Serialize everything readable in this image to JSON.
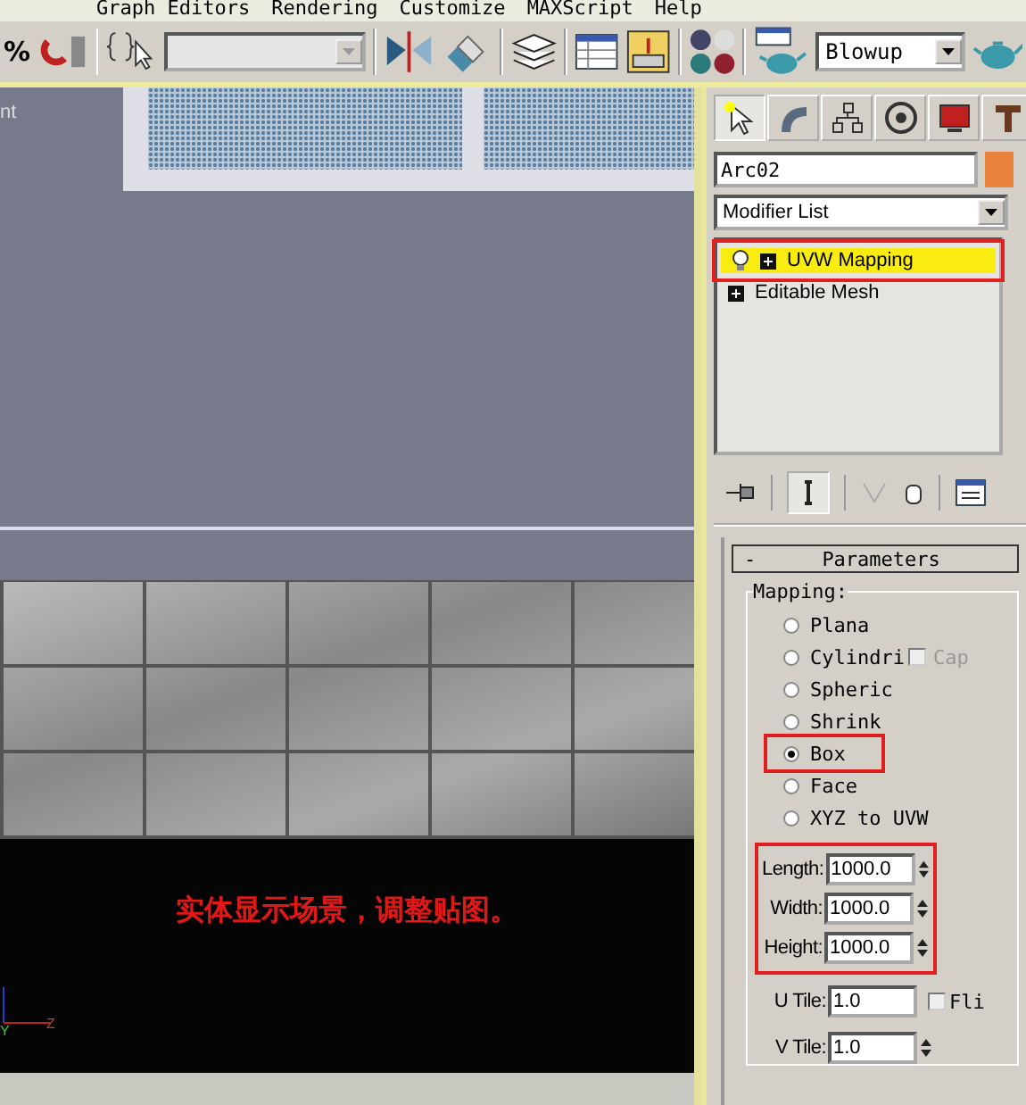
{
  "menu_bar": [
    "Graph Editors",
    "Rendering",
    "Customize",
    "MAXScript",
    "Help"
  ],
  "toolbar": {
    "snap_symbol": "%",
    "render_preset": "Blowup"
  },
  "viewport_top": {
    "label": "nt"
  },
  "viewport_bottom": {
    "caption": "实体显示场景，调整贴图。",
    "axis_labels": [
      "Y",
      "Z"
    ]
  },
  "command_panel": {
    "tabs": [
      {
        "kind": "create",
        "selected": true
      },
      {
        "kind": "modify",
        "selected": false
      },
      {
        "kind": "hierarchy",
        "selected": false
      },
      {
        "kind": "motion",
        "selected": false
      },
      {
        "kind": "display",
        "selected": false
      },
      {
        "kind": "utilities",
        "selected": false
      }
    ],
    "object_name": "Arc02",
    "color": "#e8823c",
    "modifier_list": "Modifier List",
    "stack": [
      {
        "label": "UVW Mapping",
        "selected": true,
        "highlighted": true,
        "light": true
      },
      {
        "label": "Editable Mesh",
        "selected": false,
        "highlighted": false,
        "light": false
      }
    ],
    "rollout": {
      "toggle": "-",
      "title": "Parameters",
      "group": "Mapping:",
      "options": [
        {
          "label": "Plana",
          "selected": false,
          "highlighted": false
        },
        {
          "label": "Cylindri",
          "selected": false,
          "highlighted": false,
          "cap": {
            "label": "Cap",
            "checked": false,
            "disabled": true
          }
        },
        {
          "label": "Spheric",
          "selected": false,
          "highlighted": false
        },
        {
          "label": "Shrink",
          "selected": false,
          "highlighted": false
        },
        {
          "label": "Box",
          "selected": true,
          "highlighted": true
        },
        {
          "label": "Face",
          "selected": false,
          "highlighted": false
        },
        {
          "label": "XYZ to UVW",
          "selected": false,
          "highlighted": false
        }
      ],
      "dimensions": {
        "highlighted": true,
        "fields": [
          {
            "label": "Length:",
            "value": "1000.0"
          },
          {
            "label": "Width:",
            "value": "1000.0"
          },
          {
            "label": "Height:",
            "value": "1000.0"
          }
        ]
      },
      "tiles": [
        {
          "label": "U Tile:",
          "value": "1.0",
          "flip": {
            "label": "Fli",
            "checked": false
          }
        },
        {
          "label": "V Tile:",
          "value": "1.0"
        }
      ]
    }
  }
}
